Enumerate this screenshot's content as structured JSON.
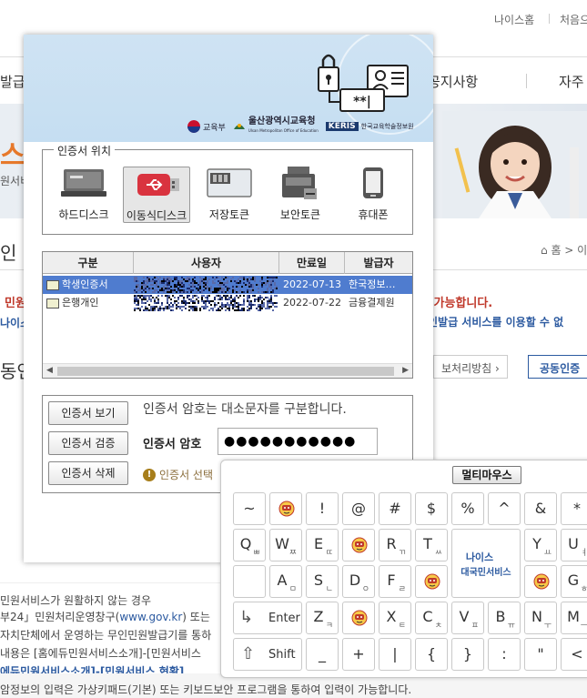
{
  "background": {
    "top_links": [
      "나이스홈",
      "처음으"
    ],
    "menu": [
      "발급",
      "공지사항",
      "자주"
    ],
    "banner_big": "스",
    "banner_small": "원서비",
    "title_fragment": "인",
    "breadcrumb": "홈 > 이",
    "red_left": "민원",
    "red_right": "이 가능합니다.",
    "blue_left": "나이스",
    "blue_right": "인발급 서비스를 이용할 수 없",
    "section_fragment": "동인",
    "btn_privacy": "보처리방침",
    "btn_common": "공동인증",
    "lines": [
      "민원서비스가 원활하지 않는 경우",
      "부24」민원처리운영창구(",
      "www.gov.kr",
      ") 또는",
      "자치단체에서 운영하는 무인민원발급기를 통하",
      "내용은 [홈에듀민원서비스소개]-[민원서비스",
      "에듀민원서비스소개]-[민원서비스 현황]",
      "암정보의 입력은 가상키패드(기본) 또는 키보드보안 프로그램을 통하여 입력이 가능합니다."
    ]
  },
  "dialog": {
    "logos": {
      "moe": "교육부",
      "ulsan": "울산광역시교육청",
      "ulsan_sub": "Ulsan Metropolitan Office of Education",
      "keris": "KERIS",
      "keris_sub": "한국교육학술정보원"
    },
    "location_legend": "인증서 위치",
    "locations": [
      {
        "label": "하드디스크",
        "icon": "hard-disk-icon"
      },
      {
        "label": "이동식디스크",
        "icon": "usb-drive-icon"
      },
      {
        "label": "저장토큰",
        "icon": "storage-token-icon"
      },
      {
        "label": "보안토큰",
        "icon": "security-token-icon"
      },
      {
        "label": "휴대폰",
        "icon": "mobile-phone-icon"
      }
    ],
    "table": {
      "headers": [
        "구분",
        "사용자",
        "만료일",
        "발급자"
      ],
      "rows": [
        {
          "type": "학생인증서",
          "user": "",
          "expiry": "2022-07-13",
          "issuer": "한국정보…"
        },
        {
          "type": "은행개인",
          "user": "",
          "expiry": "2022-07-22",
          "issuer": "금융결제원"
        }
      ]
    },
    "buttons": {
      "view": "인증서 보기",
      "verify": "인증서 검증",
      "delete": "인증서 삭제"
    },
    "note": "인증서 암호는 대소문자를 구분합니다.",
    "password_label": "인증서 암호",
    "password_value": "●●●●●●●●●●●",
    "hint": "인증서 선택"
  },
  "keyboard": {
    "multimouse": "멀티마우스",
    "row1": [
      "~",
      "",
      "!",
      "@",
      "#",
      "$",
      "%",
      "^",
      "&",
      "*"
    ],
    "row2": [
      {
        "main": "Q",
        "sub": "ㅃ"
      },
      {
        "main": "W",
        "sub": "ㅉ"
      },
      {
        "main": "E",
        "sub": "ㄸ"
      },
      {
        "main": "",
        "sub": ""
      },
      {
        "main": "R",
        "sub": "ㄲ"
      },
      {
        "main": "T",
        "sub": "ㅆ"
      },
      {
        "main": "",
        "sub": ""
      },
      {
        "main": "Y",
        "sub": "ㅛ"
      },
      {
        "main": "U",
        "sub": "ㅕ"
      }
    ],
    "row3": [
      {
        "main": "",
        "sub": ""
      },
      {
        "main": "A",
        "sub": "ㅁ"
      },
      {
        "main": "S",
        "sub": "ㄴ"
      },
      {
        "main": "D",
        "sub": "ㅇ"
      },
      {
        "main": "F",
        "sub": "ㄹ"
      },
      {
        "main": "",
        "sub": ""
      },
      {
        "main": "",
        "sub": ""
      },
      {
        "main": "",
        "sub": ""
      },
      {
        "main": "G",
        "sub": "ㅎ"
      }
    ],
    "row4": [
      {
        "main": "Z",
        "sub": "ㅋ"
      },
      {
        "main": "",
        "sub": ""
      },
      {
        "main": "X",
        "sub": "ㅌ"
      },
      {
        "main": "C",
        "sub": "ㅊ"
      },
      {
        "main": "V",
        "sub": "ㅍ"
      },
      {
        "main": "B",
        "sub": "ㅠ"
      },
      {
        "main": "N",
        "sub": "ㅜ"
      },
      {
        "main": "M",
        "sub": "ㅡ"
      }
    ],
    "row5": [
      "_",
      "+",
      "|",
      "{",
      "}",
      ":",
      "\"",
      "<"
    ],
    "enter_label": "Enter",
    "shift_label": "Shift",
    "brand_line1": "나이스",
    "brand_line2": "대국민서비스"
  }
}
